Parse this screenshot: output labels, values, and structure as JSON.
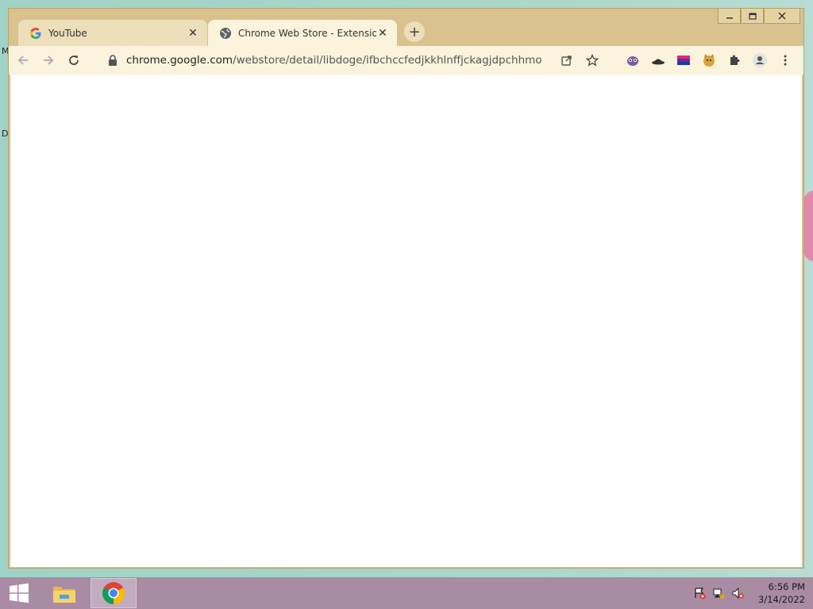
{
  "desktop": {
    "edge_letters": [
      "M",
      "D"
    ]
  },
  "tabs": [
    {
      "title": "YouTube",
      "favicon": "google-g-icon",
      "active": false
    },
    {
      "title": "Chrome Web Store - Extensions",
      "favicon": "globe-icon",
      "active": true
    }
  ],
  "new_tab_symbol": "+",
  "address_bar": {
    "host": "chrome.google.com",
    "path": "/webstore/detail/libdoge/ifbchccfedjkkhlnffjckagjdpchhmo"
  },
  "extensions": [
    "alien-extension-icon",
    "hat-extension-icon",
    "flag-extension-icon",
    "doge-extension-icon",
    "puzzle-extensions-icon"
  ],
  "taskbar": {
    "items": [
      "file-explorer-icon",
      "chrome-icon"
    ],
    "clock": {
      "time": "6:56 PM",
      "date": "3/14/2022"
    }
  },
  "colors": {
    "frame": "#d9c28f",
    "toolbar": "#fbf3dc",
    "taskbar": "#a98ba3",
    "desktop": "#a9d6cb"
  }
}
